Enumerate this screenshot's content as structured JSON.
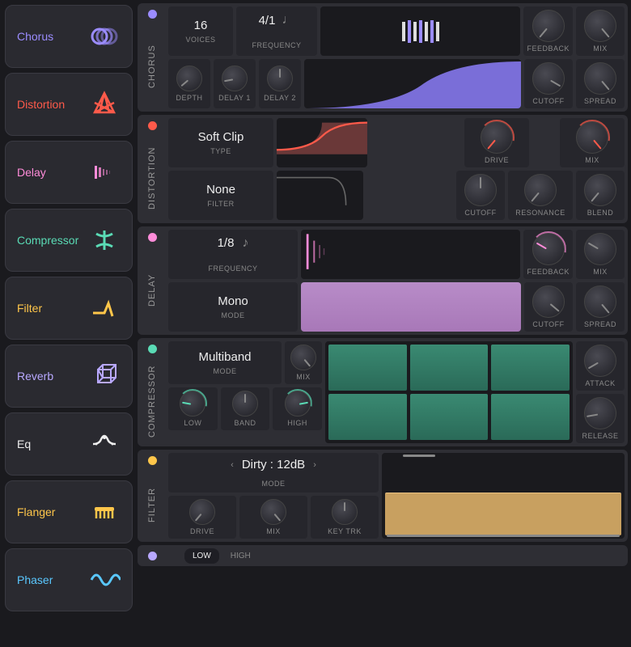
{
  "sidebar": [
    {
      "name": "Chorus",
      "color": "c-purple",
      "icon": "chorus-icon"
    },
    {
      "name": "Distortion",
      "color": "c-red",
      "icon": "distortion-icon"
    },
    {
      "name": "Delay",
      "color": "c-pink",
      "icon": "delay-icon"
    },
    {
      "name": "Compressor",
      "color": "c-teal",
      "icon": "compressor-icon"
    },
    {
      "name": "Filter",
      "color": "c-yellow",
      "icon": "filter-icon"
    },
    {
      "name": "Reverb",
      "color": "c-lav",
      "icon": "reverb-icon"
    },
    {
      "name": "Eq",
      "color": "c-white",
      "icon": "eq-icon"
    },
    {
      "name": "Flanger",
      "color": "c-yellow",
      "icon": "flanger-icon"
    },
    {
      "name": "Phaser",
      "color": "c-cyan",
      "icon": "phaser-icon"
    }
  ],
  "chorus": {
    "title": "CHORUS",
    "voices": {
      "value": "16",
      "label": "VOICES"
    },
    "frequency": {
      "value": "4/1",
      "label": "FREQUENCY"
    },
    "feedback": "FEEDBACK",
    "mix": "MIX",
    "depth": "DEPTH",
    "delay1": "DELAY 1",
    "delay2": "DELAY 2",
    "cutoff": "CUTOFF",
    "spread": "SPREAD"
  },
  "distortion": {
    "title": "DISTORTION",
    "type": {
      "value": "Soft Clip",
      "label": "TYPE"
    },
    "filter": {
      "value": "None",
      "label": "FILTER"
    },
    "drive": "DRIVE",
    "mix": "MIX",
    "cutoff": "CUTOFF",
    "resonance": "RESONANCE",
    "blend": "BLEND"
  },
  "delay": {
    "title": "DELAY",
    "frequency": {
      "value": "1/8",
      "label": "FREQUENCY"
    },
    "mode": {
      "value": "Mono",
      "label": "MODE"
    },
    "feedback": "FEEDBACK",
    "mix": "MIX",
    "cutoff": "CUTOFF",
    "spread": "SPREAD"
  },
  "compressor": {
    "title": "COMPRESSOR",
    "mode": {
      "value": "Multiband",
      "label": "MODE"
    },
    "mix": "MIX",
    "low": "LOW",
    "band": "BAND",
    "high": "HIGH",
    "attack": "ATTACK",
    "release": "RELEASE"
  },
  "filter": {
    "title": "FILTER",
    "mode": {
      "value": "Dirty : 12dB",
      "label": "MODE"
    },
    "drive": "DRIVE",
    "mix": "MIX",
    "keytrk": "KEY TRK"
  },
  "reverb": {
    "tabs": {
      "low": "LOW",
      "high": "HIGH"
    }
  }
}
